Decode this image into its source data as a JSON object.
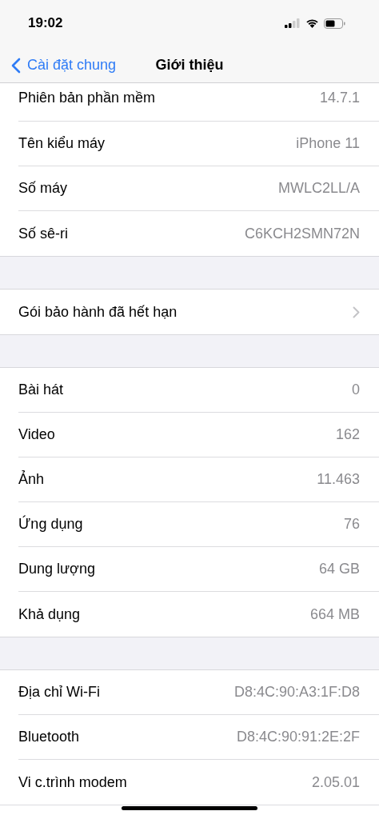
{
  "status_bar": {
    "time": "19:02"
  },
  "nav": {
    "back": "Cài đặt chung",
    "title": "Giới thiệu"
  },
  "sections": [
    {
      "rows": [
        {
          "kind": "info",
          "label": "Phiên bản phần mềm",
          "value": "14.7.1"
        },
        {
          "kind": "info",
          "label": "Tên kiểu máy",
          "value": "iPhone 11"
        },
        {
          "kind": "info",
          "label": "Số máy",
          "value": "MWLC2LL/A"
        },
        {
          "kind": "info",
          "label": "Số sê-ri",
          "value": "C6KCH2SMN72N"
        }
      ]
    },
    {
      "rows": [
        {
          "kind": "link",
          "label": "Gói bảo hành đã hết hạn"
        }
      ]
    },
    {
      "rows": [
        {
          "kind": "info",
          "label": "Bài hát",
          "value": "0"
        },
        {
          "kind": "info",
          "label": "Video",
          "value": "162"
        },
        {
          "kind": "info",
          "label": "Ảnh",
          "value": "11.463"
        },
        {
          "kind": "info",
          "label": "Ứng dụng",
          "value": "76"
        },
        {
          "kind": "info",
          "label": "Dung lượng",
          "value": "64 GB"
        },
        {
          "kind": "info",
          "label": "Khả dụng",
          "value": "664 MB"
        }
      ]
    },
    {
      "rows": [
        {
          "kind": "info",
          "label": "Địa chỉ Wi-Fi",
          "value": "D8:4C:90:A3:1F:D8"
        },
        {
          "kind": "info",
          "label": "Bluetooth",
          "value": "D8:4C:90:91:2E:2F"
        },
        {
          "kind": "info",
          "label": "Vi c.trình modem",
          "value": "2.05.01"
        }
      ]
    }
  ]
}
